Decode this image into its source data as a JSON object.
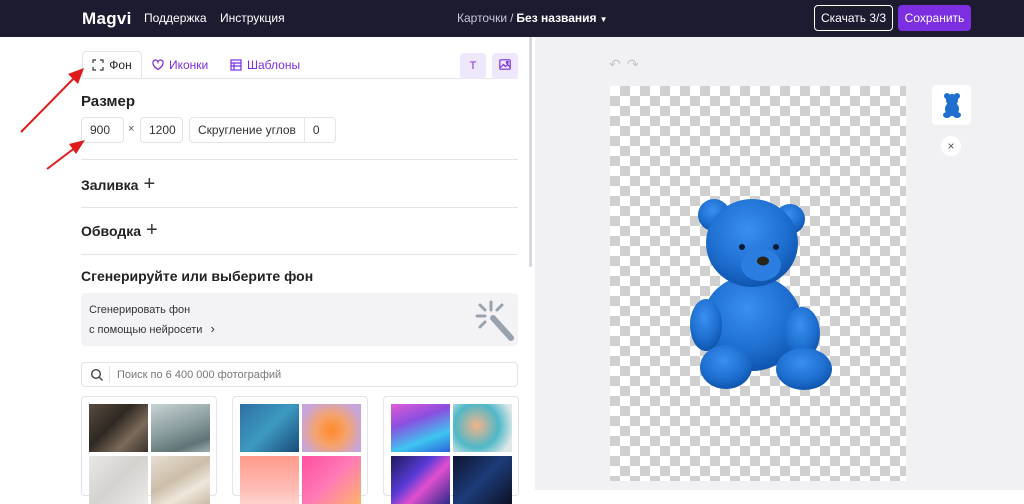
{
  "topbar": {
    "logo": "Magvi",
    "nav": [
      "Поддержка",
      "Инструкция"
    ],
    "breadcrumb": {
      "parent": "Карточки",
      "separator": "/",
      "current": "Без названия"
    },
    "download_label": "Скачать 3/3",
    "save_label": "Сохранить"
  },
  "tabs": [
    {
      "label": "Фон",
      "icon": "frame-icon"
    },
    {
      "label": "Иконки",
      "icon": "heart-icon"
    },
    {
      "label": "Шаблоны",
      "icon": "grid-icon"
    }
  ],
  "toolbar": {
    "text_label": "T",
    "image_icon": "image-icon"
  },
  "size": {
    "heading": "Размер",
    "width": "900",
    "times": "×",
    "height": "1200",
    "round_label": "Скругление углов",
    "round_value": "0"
  },
  "sections": {
    "fill": "Заливка",
    "stroke": "Обводка",
    "generate_heading": "Сгенерируйте или выберите фон"
  },
  "generate_card": {
    "line1": "Сгенерировать фон",
    "line2": "с помощью нейросети",
    "chevron": "›"
  },
  "search": {
    "placeholder": "Поиск по 6 400 000 фотографий",
    "value": ""
  },
  "colors": {
    "accent": "#7b2fe0",
    "topbar": "#1d1b2f",
    "bear": "#1e6fd0",
    "arrow": "#e0191b"
  },
  "canvas": {
    "undo_icon": "↶",
    "redo_icon": "↷",
    "close_icon": "×"
  }
}
